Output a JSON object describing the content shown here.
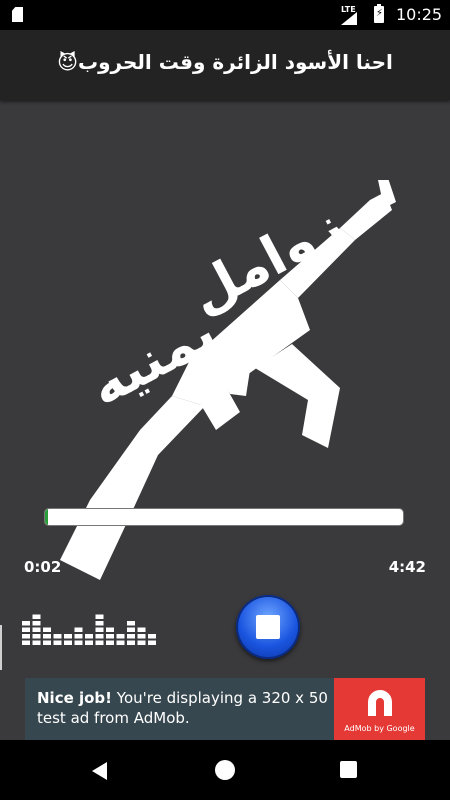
{
  "status_bar": {
    "network": "LTE",
    "time": "10:25"
  },
  "header": {
    "title": "احنا الأسود الزائرة وقت الحروب😈"
  },
  "artwork": {
    "text_line_1": "زوامل",
    "text_line_2": "يمنيه"
  },
  "player": {
    "elapsed": "0:02",
    "total": "4:42",
    "progress_percent": 0.7
  },
  "ad": {
    "headline": "Nice job!",
    "body": " You're displaying a 320 x 50 test ad from AdMob.",
    "brand": "AdMob by Google"
  },
  "colors": {
    "accent_blue": "#1a55e0",
    "progress_green": "#2a9d3a",
    "ad_red": "#e53935",
    "ad_bg": "#37474f"
  }
}
